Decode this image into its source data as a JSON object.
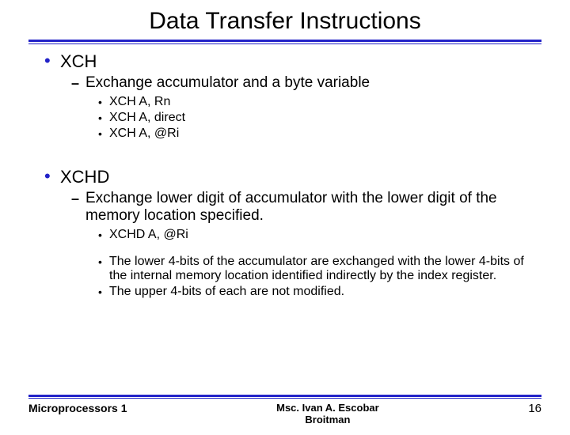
{
  "title": "Data Transfer Instructions",
  "bullets": {
    "xch": {
      "label": "XCH",
      "sub": "Exchange accumulator and a byte variable",
      "items": {
        "a": "XCH   A, Rn",
        "b": "XCH   A, direct",
        "c": "XCH   A, @Ri"
      }
    },
    "xchd": {
      "label": "XCHD",
      "sub": "Exchange lower digit of accumulator with the lower digit of the memory location specified.",
      "items": {
        "a": "XCHD A, @Ri"
      },
      "notes": {
        "a": "The lower 4-bits of the accumulator are exchanged with the lower 4-bits of the internal memory location identified indirectly by the index register.",
        "b": "The upper 4-bits of each are not modified."
      }
    }
  },
  "footer": {
    "left": "Microprocessors 1",
    "center": "Msc. Ivan A. Escobar Broitman",
    "page": "16"
  }
}
